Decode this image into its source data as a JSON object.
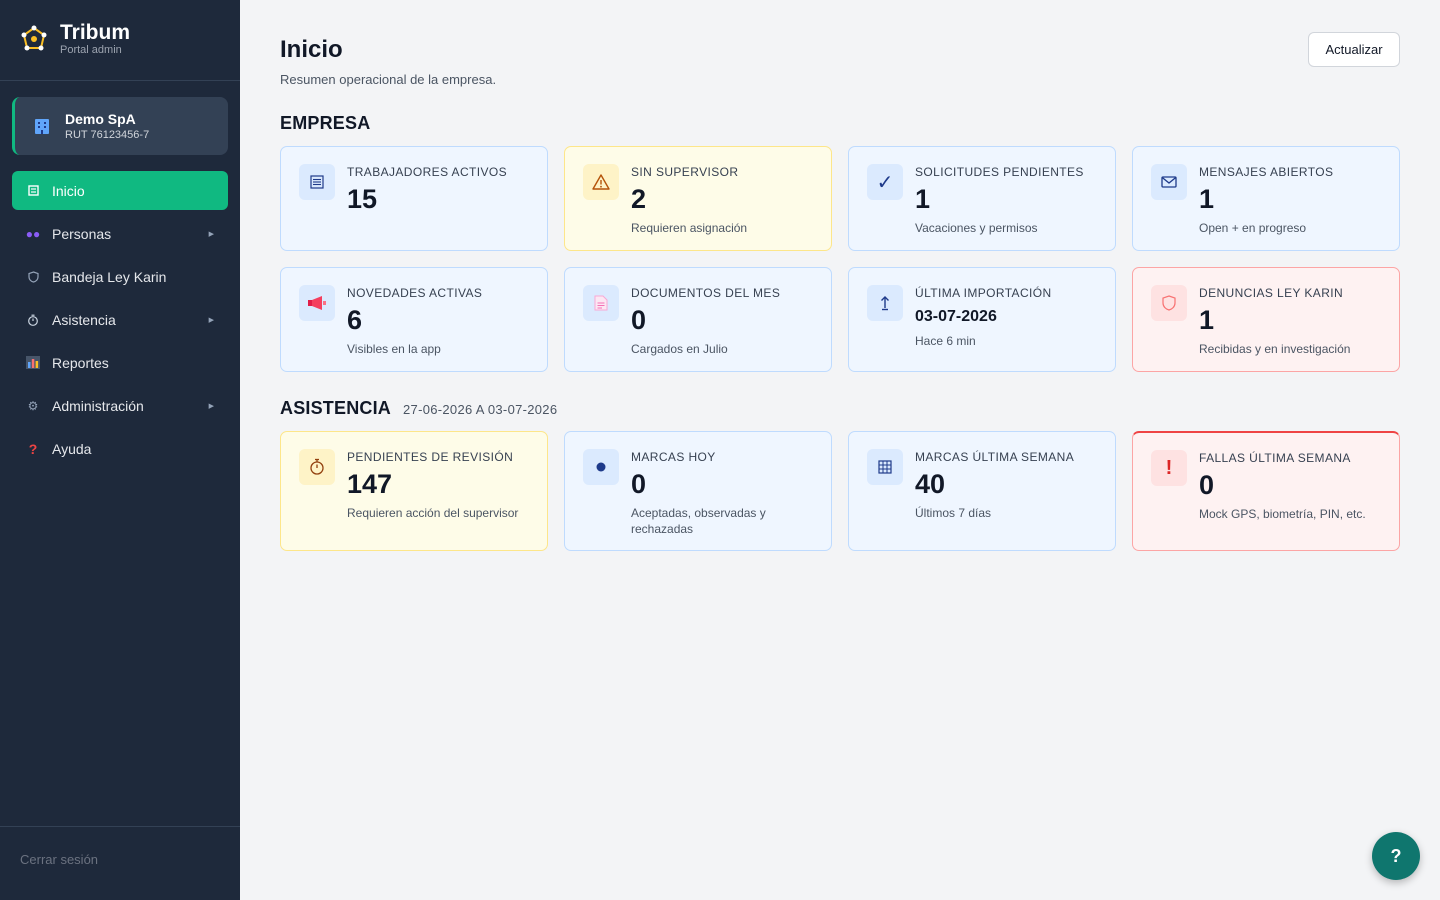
{
  "brand": {
    "title": "Tribum",
    "subtitle": "Portal admin"
  },
  "company": {
    "name": "Demo SpA",
    "rut": "RUT 76123456-7",
    "icon": "building-icon"
  },
  "nav": [
    {
      "label": "Inicio",
      "icon": "home-icon",
      "active": true,
      "expandable": false
    },
    {
      "label": "Personas",
      "icon": "people-icon",
      "active": false,
      "expandable": true
    },
    {
      "label": "Bandeja Ley Karin",
      "icon": "shield-icon",
      "active": false,
      "expandable": false
    },
    {
      "label": "Asistencia",
      "icon": "stopwatch-icon",
      "active": false,
      "expandable": true
    },
    {
      "label": "Reportes",
      "icon": "bar-chart-icon",
      "active": false,
      "expandable": false
    },
    {
      "label": "Administración",
      "icon": "gear-icon",
      "active": false,
      "expandable": true
    },
    {
      "label": "Ayuda",
      "icon": "question-icon",
      "active": false,
      "expandable": false
    }
  ],
  "logout_label": "Cerrar sesión",
  "header": {
    "title": "Inicio",
    "subtitle": "Resumen operacional de la empresa.",
    "refresh_label": "Actualizar"
  },
  "sections": {
    "empresa": {
      "title": "EMPRESA",
      "cards": [
        {
          "label": "TRABAJADORES ACTIVOS",
          "value": "15",
          "desc": "",
          "icon": "list-icon",
          "tone": "blue"
        },
        {
          "label": "SIN SUPERVISOR",
          "value": "2",
          "desc": "Requieren asignación",
          "icon": "warning-icon",
          "tone": "yellow"
        },
        {
          "label": "SOLICITUDES PENDIENTES",
          "value": "1",
          "desc": "Vacaciones y permisos",
          "icon": "check-icon",
          "tone": "blue"
        },
        {
          "label": "MENSAJES ABIERTOS",
          "value": "1",
          "desc": "Open + en progreso",
          "icon": "envelope-icon",
          "tone": "blue"
        },
        {
          "label": "NOVEDADES ACTIVAS",
          "value": "6",
          "desc": "Visibles en la app",
          "icon": "megaphone-icon",
          "tone": "blue"
        },
        {
          "label": "DOCUMENTOS DEL MES",
          "value": "0",
          "desc": "Cargados en Julio",
          "icon": "document-icon",
          "tone": "blue"
        },
        {
          "label": "ÚLTIMA IMPORTACIÓN",
          "value": "03-07-2026",
          "desc": "Hace 6 min",
          "icon": "upload-icon",
          "tone": "blue"
        },
        {
          "label": "DENUNCIAS LEY KARIN",
          "value": "1",
          "desc": "Recibidas y en investigación",
          "icon": "shield-icon",
          "tone": "red"
        }
      ]
    },
    "asistencia": {
      "title": "ASISTENCIA",
      "range": "27-06-2026 A 03-07-2026",
      "cards": [
        {
          "label": "PENDIENTES DE REVISIÓN",
          "value": "147",
          "desc": "Requieren acción del supervisor",
          "icon": "stopwatch-icon",
          "tone": "yellow"
        },
        {
          "label": "MARCAS HOY",
          "value": "0",
          "desc": "Aceptadas, observadas y rechazadas",
          "icon": "dot-icon",
          "tone": "blue"
        },
        {
          "label": "MARCAS ÚLTIMA SEMANA",
          "value": "40",
          "desc": "Últimos 7 días",
          "icon": "calendar-icon",
          "tone": "blue"
        },
        {
          "label": "FALLAS ÚLTIMA SEMANA",
          "value": "0",
          "desc": "Mock GPS, biometría, PIN, etc.",
          "icon": "exclamation-icon",
          "tone": "red"
        }
      ]
    }
  },
  "help_fab": "?",
  "colors": {
    "sidebar": "#1e293b",
    "accent": "#10b981",
    "fab": "#0f766e"
  }
}
